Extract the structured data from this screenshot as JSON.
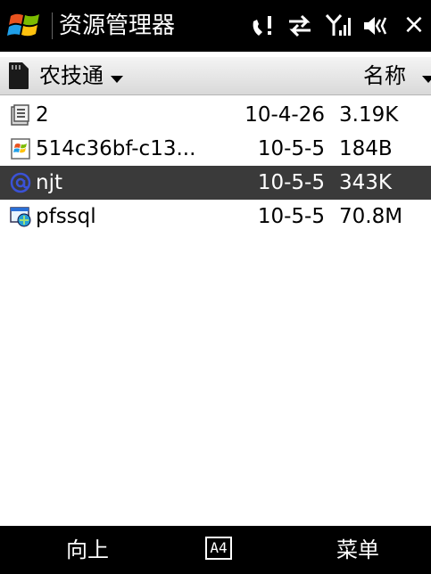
{
  "titlebar": {
    "title": "资源管理器",
    "close_glyph": "×",
    "icons": [
      "windows-flag-icon",
      "phone-signal-icon",
      "sync-icon",
      "signal-strength-icon",
      "volume-icon"
    ]
  },
  "folderbar": {
    "folder_name": "农技通",
    "sort_label": "名称"
  },
  "files": [
    {
      "name": "2",
      "date": "10-4-26",
      "size": "3.19K",
      "icon": "file-icon",
      "selected": false
    },
    {
      "name": "514c36bf-c13...",
      "date": "10-5-5",
      "size": "184B",
      "icon": "image-file-icon",
      "selected": false
    },
    {
      "name": "njt",
      "date": "10-5-5",
      "size": "343K",
      "icon": "web-file-icon",
      "selected": true
    },
    {
      "name": "pfssql",
      "date": "10-5-5",
      "size": "70.8M",
      "icon": "database-file-icon",
      "selected": false
    }
  ],
  "softbar": {
    "left": "向上",
    "ime": "A4",
    "right": "菜单"
  },
  "colors": {
    "bar_bg": "#000000",
    "selection_bg": "#3a3a3a",
    "header_bg": "#e6e6e6"
  }
}
